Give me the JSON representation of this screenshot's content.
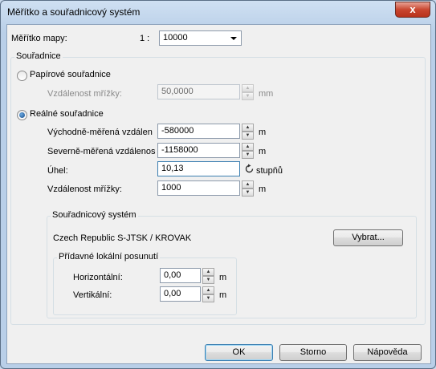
{
  "window": {
    "title": "Měřítko a souřadnicový systém",
    "close_glyph": "x"
  },
  "scale": {
    "label": "Měřítko mapy:",
    "prefix": "1 :",
    "value": "10000"
  },
  "coordinates": {
    "legend": "Souřadnice",
    "paper": {
      "label": "Papírové souřadnice",
      "selected": false,
      "grid_label": "Vzdálenost mřížky:",
      "grid_value": "50,0000",
      "grid_unit": "mm"
    },
    "real": {
      "label": "Reálné souřadnice",
      "selected": true,
      "easting_label": "Východně-měřená vzdálen",
      "easting_value": "-580000",
      "easting_unit": "m",
      "northing_label": "Severně-měřená vzdálenos",
      "northing_value": "-1158000",
      "northing_unit": "m",
      "angle_label": "Úhel:",
      "angle_value": "10,13",
      "angle_unit": "stupňů",
      "grid_label": "Vzdálenost mřížky:",
      "grid_value": "1000",
      "grid_unit": "m"
    }
  },
  "crs": {
    "legend": "Souřadnicový systém",
    "name": "Czech Republic  S-JTSK / KROVAK",
    "select_button": "Vybrat...",
    "offset": {
      "legend": "Přídavné lokální posunutí",
      "horizontal_label": "Horizontální:",
      "horizontal_value": "0,00",
      "horizontal_unit": "m",
      "vertical_label": "Vertikální:",
      "vertical_value": "0,00",
      "vertical_unit": "m"
    }
  },
  "buttons": {
    "ok": "OK",
    "cancel": "Storno",
    "help": "Nápověda"
  },
  "icons": {
    "rotate": "rotate-icon"
  }
}
